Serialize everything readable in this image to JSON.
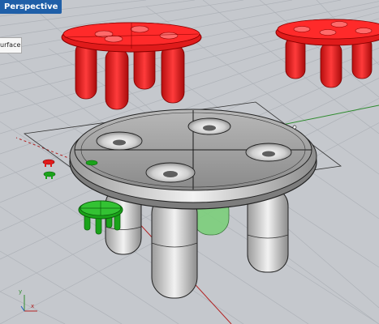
{
  "viewport": {
    "title": "Perspective"
  },
  "tooltip": {
    "text": "urface"
  },
  "scene": {
    "axis_label_y": "y",
    "axis_label_x": "x",
    "colors": {
      "background": "#c5c8cd",
      "grid": "#aeb2b8",
      "selected": "#e01b1b",
      "gumball": "#0b8a14",
      "model": "#cfcfcf",
      "x_axis": "#b22222",
      "y_axis": "#2e8b2e"
    }
  }
}
